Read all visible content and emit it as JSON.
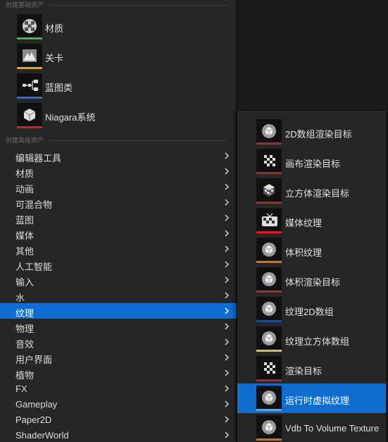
{
  "basic_section": {
    "header": "创建基础资产",
    "items": [
      {
        "label": "材质",
        "icon": "material-sphere-icon",
        "color": "#3bb84a"
      },
      {
        "label": "关卡",
        "icon": "level-mountain-icon",
        "color": "#e5a219"
      },
      {
        "label": "蓝图类",
        "icon": "blueprint-graph-icon",
        "color": "#2f6bd8"
      },
      {
        "label": "Niagara系统",
        "icon": "niagara-system-icon",
        "color": "#d41e1e"
      }
    ]
  },
  "advanced_section": {
    "header": "创建高级资产",
    "items": [
      {
        "label": "编辑器工具"
      },
      {
        "label": "材质"
      },
      {
        "label": "动画"
      },
      {
        "label": "可混合物"
      },
      {
        "label": "蓝图"
      },
      {
        "label": "媒体"
      },
      {
        "label": "其他"
      },
      {
        "label": "人工智能"
      },
      {
        "label": "输入"
      },
      {
        "label": "水"
      },
      {
        "label": "纹理",
        "selected": true
      },
      {
        "label": "物理"
      },
      {
        "label": "音效"
      },
      {
        "label": "用户界面"
      },
      {
        "label": "植物"
      },
      {
        "label": "FX"
      },
      {
        "label": "Gameplay"
      },
      {
        "label": "Paper2D"
      },
      {
        "label": "ShaderWorld"
      }
    ]
  },
  "texture_submenu": {
    "items": [
      {
        "label": "2D数组渲染目标",
        "icon": "cube-sphere-icon",
        "color": "#7a3b3b"
      },
      {
        "label": "画布渲染目标",
        "icon": "checker-pattern-icon",
        "color": "#7a3b3b"
      },
      {
        "label": "立方体渲染目标",
        "icon": "cube-checker-icon",
        "color": "#7a3b3b"
      },
      {
        "label": "媒体纹理",
        "icon": "tv-icon",
        "color": "#d41e1e"
      },
      {
        "label": "体积纹理",
        "icon": "cube-sphere-icon",
        "color": "#b07a3a"
      },
      {
        "label": "体积渲染目标",
        "icon": "cube-sphere-icon",
        "color": "#7a3b3b"
      },
      {
        "label": "纹理2D数组",
        "icon": "cube-sphere-icon",
        "color": "#1f4b8a"
      },
      {
        "label": "纹理立方体数组",
        "icon": "cube-sphere-icon",
        "color": "#c9c08a"
      },
      {
        "label": "渲染目标",
        "icon": "checker-pattern-icon",
        "color": "#7a3b3b"
      },
      {
        "label": "运行时虚拟纹理",
        "icon": "cube-sphere-icon",
        "color": "#6aa0d8",
        "selected": true
      },
      {
        "label": "Vdb To Volume Texture",
        "icon": "cube-sphere-icon",
        "color": "#b07a3a"
      }
    ]
  },
  "colors": {
    "selection": "#0e6fd1",
    "menu_bg": "#262626"
  }
}
